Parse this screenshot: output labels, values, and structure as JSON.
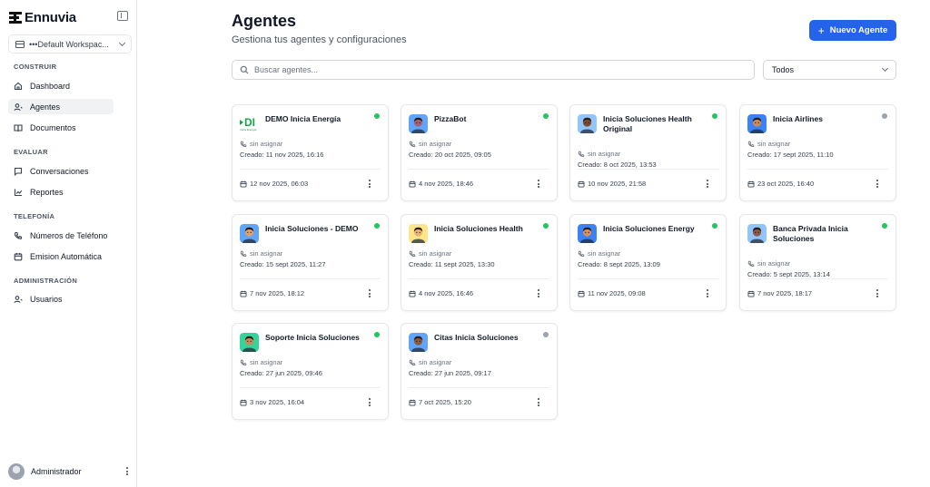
{
  "brand": {
    "name": "Ennuvia"
  },
  "workspace": {
    "label": "•••Default Workspac..."
  },
  "sidebar": {
    "sections": [
      {
        "title": "CONSTRUIR",
        "items": [
          {
            "label": "Dashboard",
            "icon": "home-icon"
          },
          {
            "label": "Agentes",
            "icon": "user-icon",
            "active": true
          },
          {
            "label": "Documentos",
            "icon": "book-icon"
          }
        ]
      },
      {
        "title": "EVALUAR",
        "items": [
          {
            "label": "Conversaciones",
            "icon": "message-icon"
          },
          {
            "label": "Reportes",
            "icon": "chart-icon"
          }
        ]
      },
      {
        "title": "TELEFONÍA",
        "items": [
          {
            "label": "Números de Teléfono",
            "icon": "phone-icon"
          },
          {
            "label": "Emision Automática",
            "icon": "calendar-icon"
          }
        ]
      },
      {
        "title": "ADMINISTRACIÓN",
        "items": [
          {
            "label": "Usuarios",
            "icon": "user-icon"
          }
        ]
      }
    ],
    "user": {
      "name": "Administrador"
    }
  },
  "header": {
    "title": "Agentes",
    "subtitle": "Gestiona tus agentes y configuraciones",
    "new_button": "Nuevo Agente"
  },
  "search": {
    "placeholder": "Buscar agentes..."
  },
  "filter": {
    "selected": "Todos"
  },
  "colors": {
    "primary": "#2563eb",
    "active": "#22c55e",
    "inactive": "#9ca3af"
  },
  "agents": [
    {
      "name": "DEMO Inicia Energía",
      "avatar": "logo",
      "active": true,
      "assigned": "sin asignar",
      "created": "Creado: 11 nov 2025, 16:16",
      "updated": "12 nov 2025, 06:03",
      "logo_text": "DI",
      "logo_sub": "Inicia Energía"
    },
    {
      "name": "PizzaBot",
      "avatar": "person",
      "skin": "#a1627a",
      "bg": "#60a5fa",
      "active": true,
      "assigned": "sin asignar",
      "created": "Creado: 20 oct 2025, 09:05",
      "updated": "4 nov 2025, 18:46"
    },
    {
      "name": "Inicia Soluciones Health Original",
      "avatar": "person",
      "skin": "#7c4a2d",
      "bg": "#93c5fd",
      "active": true,
      "assigned": "sin asignar",
      "created": "Creado: 8 oct 2025, 13:53",
      "updated": "10 nov 2025, 21:58"
    },
    {
      "name": "Inicia Airlines",
      "avatar": "person",
      "skin": "#d08b5b",
      "bg": "#3b82f6",
      "active": false,
      "assigned": "sin asignar",
      "created": "Creado: 17 sept 2025, 11:10",
      "updated": "23 oct 2025, 16:40"
    },
    {
      "name": "Inicia Soluciones - DEMO",
      "avatar": "person",
      "skin": "#e0a06a",
      "bg": "#60a5fa",
      "active": true,
      "assigned": "sin asignar",
      "created": "Creado: 15 sept 2025, 11:27",
      "updated": "7 nov 2025, 18:12"
    },
    {
      "name": "Inicia Soluciones Health",
      "avatar": "person",
      "skin": "#e8b07a",
      "bg": "#fde68a",
      "active": true,
      "assigned": "sin asignar",
      "created": "Creado: 11 sept 2025, 13:30",
      "updated": "4 nov 2025, 16:46"
    },
    {
      "name": "Inicia Soluciones Energy",
      "avatar": "person",
      "skin": "#d9905e",
      "bg": "#3b82f6",
      "active": true,
      "assigned": "sin asignar",
      "created": "Creado: 8 sept 2025, 13:09",
      "updated": "11 nov 2025, 09:08"
    },
    {
      "name": "Banca Privada Inicia Soluciones",
      "avatar": "person",
      "skin": "#8a5a44",
      "bg": "#93c5fd",
      "active": true,
      "assigned": "sin asignar",
      "created": "Creado: 5 sept 2025, 13:14",
      "updated": "7 nov 2025, 18:17"
    },
    {
      "name": "Soporte Inicia Soluciones",
      "avatar": "person",
      "skin": "#c98a5a",
      "bg": "#34d399",
      "active": true,
      "assigned": "sin asignar",
      "created": "Creado: 27 jun 2025, 09:46",
      "updated": "3 nov 2025, 16:04"
    },
    {
      "name": "Citas Inicia Soluciones",
      "avatar": "person",
      "skin": "#8b5a3c",
      "bg": "#60a5fa",
      "active": false,
      "assigned": "sin asignar",
      "created": "Creado: 27 jun 2025, 09:17",
      "updated": "7 oct 2025, 15:20"
    }
  ]
}
